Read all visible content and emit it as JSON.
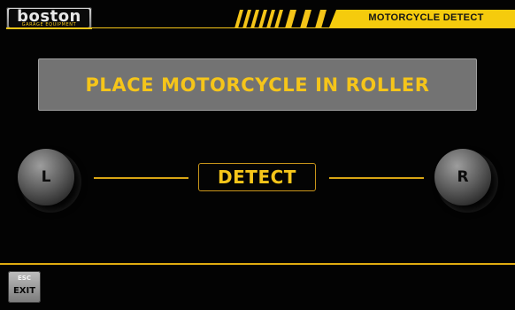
{
  "header": {
    "logo_word": "boston",
    "logo_tagline": "GARAGE EQUIPMENT",
    "title": "MOTORCYCLE DETECT"
  },
  "main": {
    "message": "PLACE MOTORCYCLE IN ROLLER",
    "left_roller": "L",
    "right_roller": "R",
    "detect_label": "DETECT"
  },
  "footer": {
    "exit_key": "ESC",
    "exit_label": "EXIT"
  },
  "colors": {
    "accent": "#f5c518",
    "background": "#030303",
    "panel": "#737373"
  }
}
